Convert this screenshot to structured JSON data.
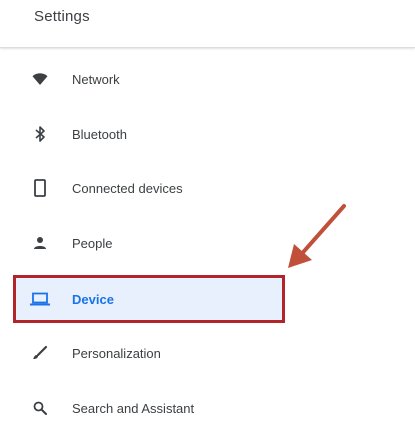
{
  "header": {
    "title": "Settings"
  },
  "menu": {
    "items": [
      {
        "label": "Network",
        "icon": "wifi-icon"
      },
      {
        "label": "Bluetooth",
        "icon": "bluetooth-icon"
      },
      {
        "label": "Connected devices",
        "icon": "phone-icon"
      },
      {
        "label": "People",
        "icon": "person-icon"
      },
      {
        "label": "Device",
        "icon": "laptop-icon",
        "selected": true
      },
      {
        "label": "Personalization",
        "icon": "brush-icon"
      },
      {
        "label": "Search and Assistant",
        "icon": "search-icon"
      }
    ]
  },
  "colors": {
    "accent": "#1a73e8",
    "selected_bg": "#e8f0fe",
    "annotation": "#b3232a",
    "arrow": "#c0503a",
    "text": "#3c4043"
  }
}
